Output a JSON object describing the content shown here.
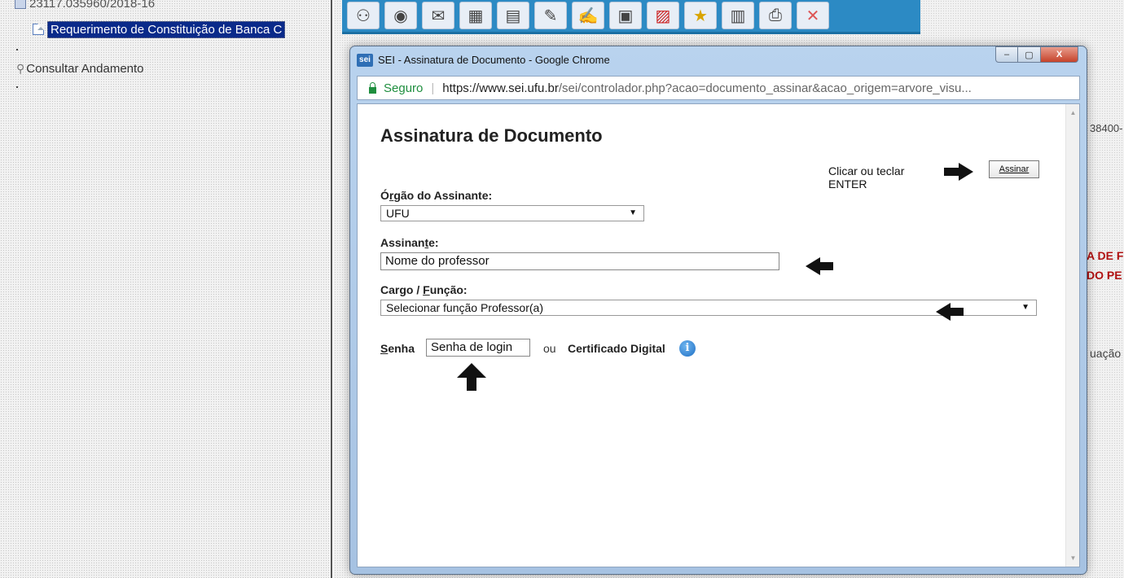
{
  "tree": {
    "process_number": "23117.035960/2018-16",
    "document": "Requerimento de Constituição de Banca C",
    "consult": "Consultar Andamento"
  },
  "background": {
    "side_number": "38400-",
    "side_red_1": "A DE F",
    "side_red_2": "DO PE",
    "side_text": "uação"
  },
  "toolbar": {
    "icons": [
      "people-icon",
      "eye-icon",
      "envelope-icon",
      "chart-icon",
      "document-icon",
      "pen-icon",
      "sign-icon",
      "box-icon",
      "cancel-icon",
      "star-icon",
      "files-icon",
      "printer-icon",
      "cross-icon"
    ]
  },
  "window": {
    "logo": "sei",
    "title": "SEI - Assinatura de Documento - Google Chrome",
    "minimize": "–",
    "maximize": "▢",
    "close": "X"
  },
  "addressbar": {
    "secure": "Seguro",
    "separator": "|",
    "url_host": "https://www.sei.ufu.br",
    "url_path": "/sei/controlador.php?acao=documento_assinar&acao_origem=arvore_visu..."
  },
  "form": {
    "title": "Assinatura de Documento",
    "hint": "Clicar ou teclar ENTER",
    "sign_button": "Assinar",
    "org_label_pre": "Ó",
    "org_label_u": "r",
    "org_label_post": "gão do Assinante:",
    "org_value": "UFU",
    "signer_label_pre": "Assinan",
    "signer_label_u": "t",
    "signer_label_post": "e:",
    "signer_value": "Nome do professor",
    "role_label_pre": "Cargo / ",
    "role_label_u": "F",
    "role_label_post": "unção:",
    "role_value": "Selecionar função Professor(a)",
    "password_label_u": "S",
    "password_label_post": "enha",
    "password_value": "Senha de login",
    "or_label": "ou",
    "cert_label": "Certificado Digital",
    "info_icon": "i",
    "caret": "▼"
  }
}
